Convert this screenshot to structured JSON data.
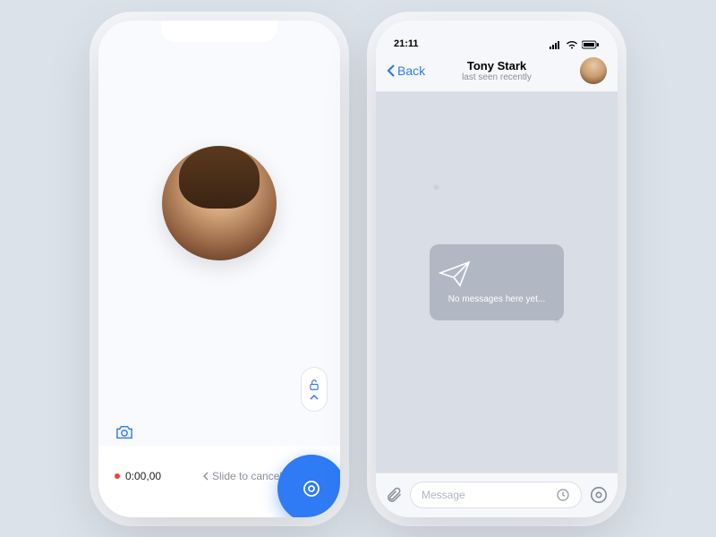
{
  "left": {
    "recording": {
      "timer": "0:00,00",
      "slide_hint": "Slide to cancel"
    }
  },
  "right": {
    "status": {
      "time": "21:11"
    },
    "header": {
      "back_label": "Back",
      "name": "Tony Stark",
      "subtitle": "last seen recently"
    },
    "empty_state": "No messages here yet...",
    "input": {
      "placeholder": "Message"
    }
  }
}
